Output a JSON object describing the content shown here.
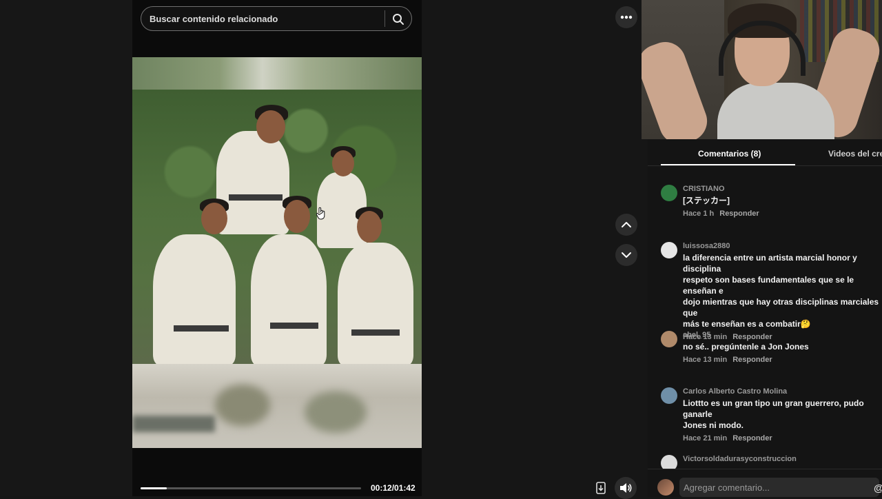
{
  "search": {
    "placeholder": "Buscar contenido relacionado"
  },
  "player": {
    "current_time": "00:12/01:42",
    "progress_fraction": 0.12
  },
  "tabs": [
    {
      "label": "Comentarios (8)"
    },
    {
      "label": "Videos del crea"
    }
  ],
  "comments": [
    {
      "username": "CRISTIANO",
      "text": "[ステッカー]",
      "time": "Hace 1 h",
      "reply": "Responder",
      "avatar_color": "#2f7d42"
    },
    {
      "username": "luissosa2880",
      "text": "la diferencia entre un artista marcial honor y disciplina\nrespeto son bases fundamentales que se le enseñan e\ndojo mientras que hay otras disciplinas marciales que\nmás te enseñan es a combatir🤔",
      "time": "Hace 13 min",
      "reply": "Responder",
      "avatar_color": "#e6e6e6"
    },
    {
      "username": "abel_95",
      "text": "no sé.. pregúntenle a Jon Jones",
      "time": "Hace 13 min",
      "reply": "Responder",
      "avatar_color": "#b08a6a"
    },
    {
      "username": "Carlos Alberto Castro Molina",
      "text": "Liottto es un gran tipo un gran guerrero, pudo ganarle\nJones ni modo.",
      "time": "Hace 21 min",
      "reply": "Responder",
      "avatar_color": "#6f8fa8"
    },
    {
      "username": "Victorsoldadurasyconstruccion",
      "text": "",
      "time": "",
      "reply": "",
      "avatar_color": "#dcdcdc"
    }
  ],
  "add_comment": {
    "placeholder": "Agregar comentario...",
    "at_symbol": "@"
  },
  "icons": {
    "search": "search-icon",
    "more": "more-horizontal-icon",
    "up": "chevron-up-icon",
    "down": "chevron-down-icon",
    "volume": "volume-icon",
    "download": "download-icon"
  }
}
